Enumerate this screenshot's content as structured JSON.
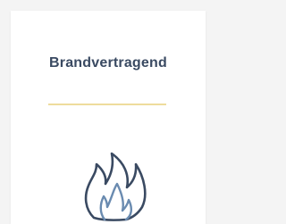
{
  "card": {
    "title": "Brandvertragend",
    "icon": "flame-icon"
  },
  "colors": {
    "title": "#3a4a62",
    "divider": "#eedc9c",
    "icon_outer": "#3a4a62",
    "icon_inner": "#6a8bb0"
  }
}
